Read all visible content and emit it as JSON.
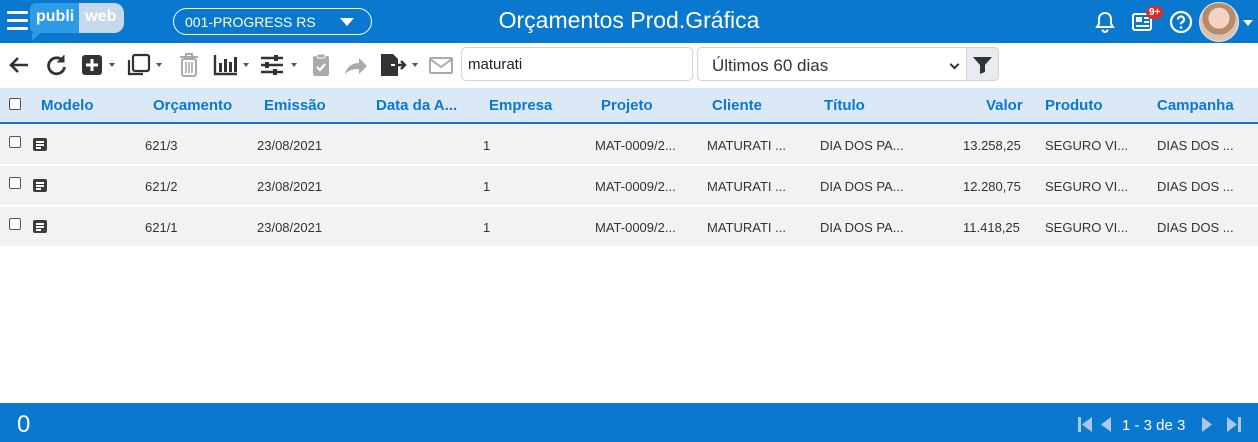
{
  "header": {
    "logo_left": "publi",
    "logo_right": "web",
    "company": "001-PROGRESS RS",
    "title": "Orçamentos Prod.Gráfica",
    "notifications_badge": "9+",
    "icons": [
      "menu-icon",
      "bell-icon",
      "news-icon",
      "help-icon",
      "avatar"
    ]
  },
  "toolbar": {
    "search_value": "maturati",
    "period": "Últimos 60 dias",
    "icons": [
      "back-arrow-icon",
      "refresh-icon",
      "add-icon",
      "duplicate-icon",
      "trash-icon",
      "chart-icon",
      "sliders-icon",
      "clipboard-check-icon",
      "share-icon",
      "export-icon",
      "envelope-icon",
      "filter-icon"
    ]
  },
  "table": {
    "columns": [
      "Modelo",
      "Orçamento",
      "Emissão",
      "Data da A...",
      "Empresa",
      "Projeto",
      "Cliente",
      "Título",
      "Valor",
      "Produto",
      "Campanha"
    ],
    "rows": [
      {
        "orcamento": "621/3",
        "emissao": "23/08/2021",
        "data": "",
        "empresa": "1",
        "projeto": "MAT-0009/2...",
        "cliente": "MATURATI ...",
        "titulo": "DIA DOS PA...",
        "valor": "13.258,25",
        "produto": "SEGURO VI...",
        "campanha": "DIAS DOS ..."
      },
      {
        "orcamento": "621/2",
        "emissao": "23/08/2021",
        "data": "",
        "empresa": "1",
        "projeto": "MAT-0009/2...",
        "cliente": "MATURATI ...",
        "titulo": "DIA DOS PA...",
        "valor": "12.280,75",
        "produto": "SEGURO VI...",
        "campanha": "DIAS DOS ..."
      },
      {
        "orcamento": "621/1",
        "emissao": "23/08/2021",
        "data": "",
        "empresa": "1",
        "projeto": "MAT-0009/2...",
        "cliente": "MATURATI ...",
        "titulo": "DIA DOS PA...",
        "valor": "11.418,25",
        "produto": "SEGURO VI...",
        "campanha": "DIAS DOS ..."
      }
    ]
  },
  "footer": {
    "total": "0",
    "pager": "1 - 3 de 3"
  },
  "colors": {
    "primary": "#0b78d0",
    "header_row_bg": "#dbe9f7",
    "badge": "#d93025"
  }
}
